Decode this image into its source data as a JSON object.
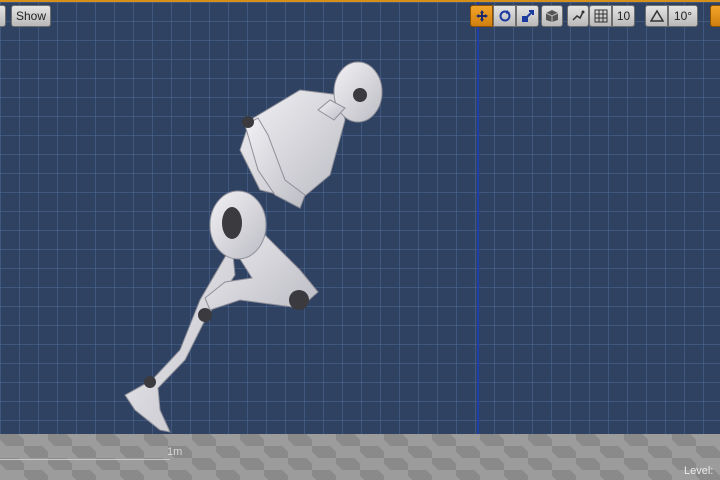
{
  "toolbar": {
    "show_label": "Show",
    "translate_snap": "10",
    "rotate_snap": "10°",
    "icons": {
      "left_stub": "dropdown-stub-icon",
      "translate": "translate-icon",
      "rotate": "rotate-icon",
      "scale": "scale-icon",
      "surface_snap": "cube-icon",
      "coordinate": "snap-tool-icon",
      "grid_snap": "grid-icon",
      "rotation_snap": "triangle-icon"
    }
  },
  "viewport": {
    "scale_label": "1m",
    "level_label": "Level:"
  },
  "colors": {
    "accent": "#d68f18",
    "background": "#2f4262",
    "axis_line": "#1e3fa8",
    "mannequin": "#e6e6ea"
  }
}
